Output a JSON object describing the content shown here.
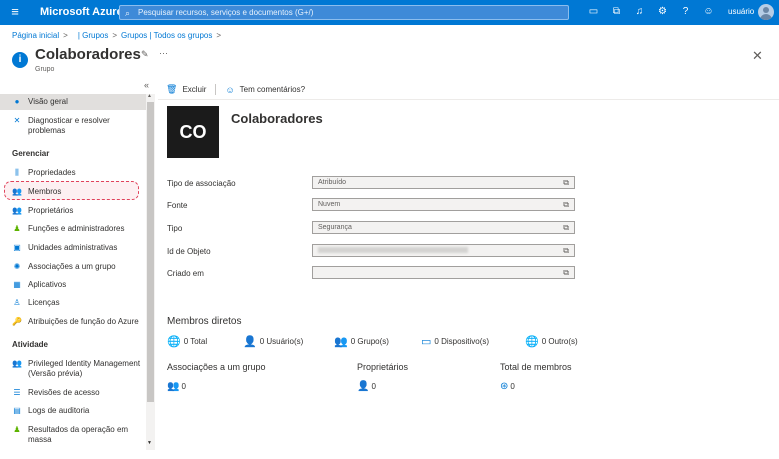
{
  "topbar": {
    "brand": "Microsoft Azure",
    "search_placeholder": "Pesquisar recursos, serviços e documentos (G+/)",
    "user": "usuário",
    "icons": [
      "cloud-shell-icon",
      "directory-filter-icon",
      "notifications-icon",
      "settings-icon",
      "help-icon",
      "feedback-icon"
    ]
  },
  "breadcrumb": {
    "home": "Página inicial",
    "groups": "| Grupos",
    "all_groups": "Grupos | Todos os grupos",
    "sep": ">"
  },
  "header": {
    "title": "Colaboradores",
    "subtitle": "Grupo",
    "more": "···",
    "close": "✕"
  },
  "sidebar": {
    "collapse": "«",
    "items": [
      {
        "label": "Visão geral",
        "icon": "info-icon"
      },
      {
        "label": "Diagnosticar e resolver problemas",
        "icon": "wrench-icon"
      }
    ],
    "section_manage": "Gerenciar",
    "manage_items": [
      {
        "label": "Propriedades",
        "icon": "properties-icon"
      },
      {
        "label": "Membros",
        "icon": "members-icon"
      },
      {
        "label": "Proprietários",
        "icon": "owners-icon"
      },
      {
        "label": "Funções e administradores",
        "icon": "roles-icon"
      },
      {
        "label": "Unidades administrativas",
        "icon": "admin-units-icon"
      },
      {
        "label": "Associações a um grupo",
        "icon": "group-memberships-icon"
      },
      {
        "label": "Aplicativos",
        "icon": "apps-icon"
      },
      {
        "label": "Licenças",
        "icon": "licenses-icon"
      },
      {
        "label": "Atribuições de função do Azure",
        "icon": "key-icon"
      }
    ],
    "section_activity": "Atividade",
    "activity_items": [
      {
        "label": "Privileged Identity Management (Versão prévia)",
        "icon": "pim-icon"
      },
      {
        "label": "Revisões de acesso",
        "icon": "access-reviews-icon"
      },
      {
        "label": "Logs de auditoria",
        "icon": "audit-logs-icon"
      },
      {
        "label": "Resultados da operação em massa",
        "icon": "bulk-results-icon"
      }
    ]
  },
  "toolbar": {
    "delete": "Excluir",
    "feedback": "Tem comentários?"
  },
  "group": {
    "initials": "CO",
    "name": "Colaboradores"
  },
  "properties": {
    "membership_type_label": "Tipo de associação",
    "membership_type_value": "Atribuído",
    "source_label": "Fonte",
    "source_value": "Nuvem",
    "type_label": "Tipo",
    "type_value": "Segurança",
    "object_id_label": "Id de Objeto",
    "object_id_value": "",
    "created_label": "Criado em",
    "created_value": ""
  },
  "direct_members": {
    "title": "Membros diretos",
    "total": "0 Total",
    "users": "0 Usuário(s)",
    "groups": "0 Grupo(s)",
    "devices": "0 Dispositivo(s)",
    "others": "0 Outro(s)"
  },
  "summary": {
    "group_memberships_title": "Associações a um grupo",
    "group_memberships_value": "0",
    "owners_title": "Proprietários",
    "owners_value": "0",
    "total_members_title": "Total de membros",
    "total_members_value": "0"
  }
}
